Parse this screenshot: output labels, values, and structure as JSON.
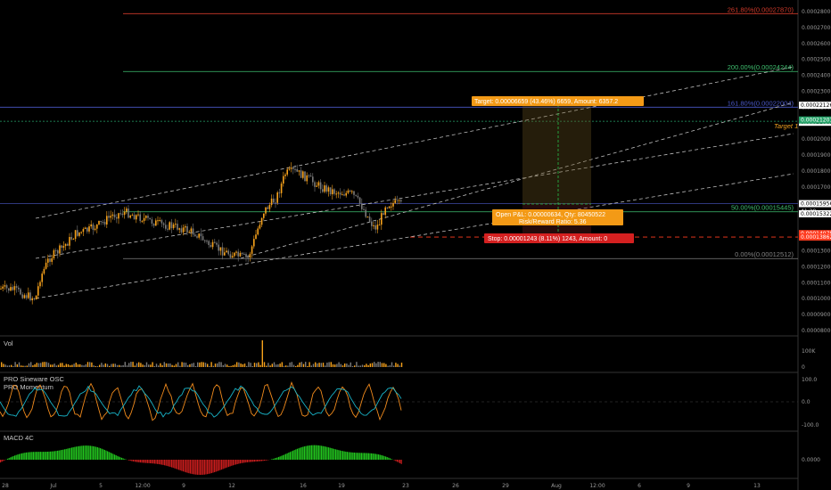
{
  "panes": {
    "price": {
      "label": ""
    },
    "volume": {
      "label": "Vol"
    },
    "sineware": {
      "label": "PRO Sineware OSC"
    },
    "momentum": {
      "label": "PRO Momentum"
    },
    "macd": {
      "label": "MACD 4C"
    }
  },
  "chart_data": {
    "type": "candlestick",
    "ylim": [
      8e-05,
      0.00029
    ],
    "y_ticks": [
      "0.00028000",
      "0.00027000",
      "0.00026000",
      "0.00025000",
      "0.00024000",
      "0.00023000",
      "0.00022000",
      "0.00020000",
      "0.00019000",
      "0.00018000",
      "0.00017000",
      "0.00016000",
      "0.00014000",
      "0.00013000",
      "0.00012000",
      "0.00011000",
      "0.00010000",
      "0.00009000",
      "0.00008000"
    ],
    "x_ticks": [
      "28",
      "Jul",
      "5",
      "12:00",
      "9",
      "12",
      "16",
      "19",
      "23",
      "26",
      "29",
      "Aug",
      "12:00",
      "6",
      "9",
      "13"
    ],
    "fib_levels": [
      {
        "label": "261.80%(0.00027870)",
        "value": 0.0002787,
        "color": "#d03a2a"
      },
      {
        "label": "200.00%(0.00024244)",
        "value": 0.00024244,
        "color": "#3fbf6f"
      },
      {
        "label": "161.80%(0.00022004)",
        "value": 0.00022004,
        "color": "#4a58c8"
      },
      {
        "label": "50.00%(0.00015445)",
        "value": 0.00015445,
        "color": "#3fbf6f"
      },
      {
        "label": "0.00%(0.00012512)",
        "value": 0.00012512,
        "color": "#808080"
      }
    ],
    "price_markers": [
      {
        "text": "0.00022126",
        "value": 0.00022126,
        "bg": "#ffffff",
        "fg": "#000000"
      },
      {
        "text": "0.00021061",
        "value": 0.00021061,
        "bg": "#ffffff",
        "fg": "#000000"
      },
      {
        "text": "0.00021201",
        "value": 0.000212,
        "bg": "#26a269",
        "fg": "#ffffff"
      },
      {
        "text": "0.00015956",
        "value": 0.00015956,
        "bg": "#ffffff",
        "fg": "#000000"
      },
      {
        "text": "41:29",
        "value": 0.000155,
        "bg": "#000000",
        "fg": "#dddddd"
      },
      {
        "text": "0.00015322",
        "value": 0.00015322,
        "bg": "#ffffff",
        "fg": "#000000"
      },
      {
        "text": "0.00014079",
        "value": 0.00014079,
        "bg": "#ff3b1f",
        "fg": "#ffffff"
      },
      {
        "text": "0.00013862",
        "value": 0.00013862,
        "bg": "#ff3b1f",
        "fg": "#ffffff"
      }
    ],
    "target1_label": "Target 1",
    "target1_value": 0.0002112,
    "position": {
      "target_text": "Target: 0.00006659 (43.46%) 6659, Amount: 6357.2",
      "open_text_1": "Open P&L: 0.00000634, Qty: 80450522",
      "open_text_2": "Risk/Reward Ratio: 5.36",
      "stop_text": "Stop: 0.00001243 (8.11%) 1243, Amount: 0"
    },
    "volume_ticks": [
      "100K",
      "0"
    ],
    "osc_ticks": [
      "100.0",
      "0.0",
      "-100.0"
    ],
    "macd_ticks": [
      "0.0000"
    ]
  },
  "colors": {
    "bull": "#f7a21b",
    "bear": "#7a7a7a",
    "grid": "#2a2a2a",
    "channel": "#bdbdbd",
    "macd_pos": "#22c41e",
    "macd_neg": "#c81d1d",
    "sine": "#18b4c8",
    "momentum": "#f08a1c"
  }
}
